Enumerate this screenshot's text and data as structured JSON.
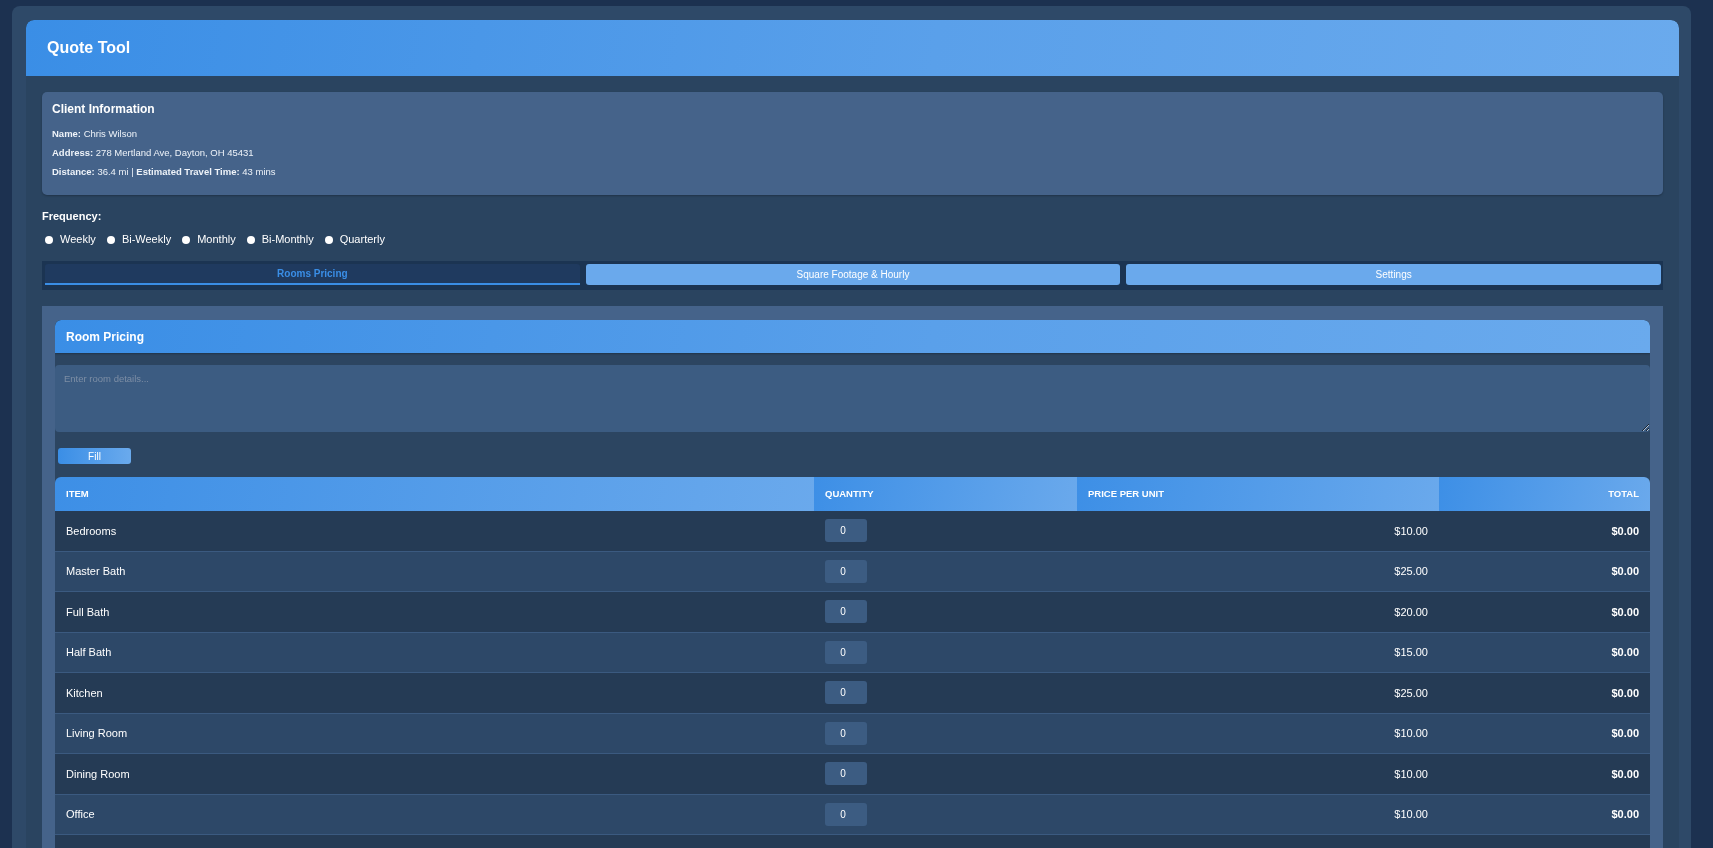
{
  "window": {
    "title": "Quote Tool"
  },
  "client_info": {
    "title": "Client Information",
    "lines": [
      "**Name:** Chris Wilson",
      "**Address:** 278 Mertland Ave, Dayton, OH 45431",
      "**Distance:** 36.4 mi | **Estimated Travel Time:** 43 mins"
    ]
  },
  "frequency": {
    "label": "Frequency:",
    "options": [
      {
        "label": "Weekly",
        "selected": false
      },
      {
        "label": "Bi-Weekly",
        "selected": false
      },
      {
        "label": "Monthly",
        "selected": false
      },
      {
        "label": "Bi-Monthly",
        "selected": false
      },
      {
        "label": "Quarterly",
        "selected": false
      }
    ]
  },
  "tabs": [
    {
      "label": "Rooms Pricing",
      "selected": true
    },
    {
      "label": "Square Footage & Hourly",
      "selected": false
    },
    {
      "label": "Settings",
      "selected": false
    }
  ],
  "room_pricing": {
    "title": "Room Pricing",
    "details_field": {
      "placeholder": "Enter room details..."
    },
    "fill_button": "Fill",
    "table": {
      "columns": [
        "ITEM",
        "QUANTITY",
        "PRICE PER UNIT",
        "TOTAL"
      ],
      "rows": [
        {
          "item": "Bedrooms",
          "quantity": "0",
          "price_per_unit": "$10.00",
          "total": "$0.00"
        },
        {
          "item": "Master Bath",
          "quantity": "0",
          "price_per_unit": "$25.00",
          "total": "$0.00"
        },
        {
          "item": "Full Bath",
          "quantity": "0",
          "price_per_unit": "$20.00",
          "total": "$0.00"
        },
        {
          "item": "Half Bath",
          "quantity": "0",
          "price_per_unit": "$15.00",
          "total": "$0.00"
        },
        {
          "item": "Kitchen",
          "quantity": "0",
          "price_per_unit": "$25.00",
          "total": "$0.00"
        },
        {
          "item": "Living Room",
          "quantity": "0",
          "price_per_unit": "$10.00",
          "total": "$0.00"
        },
        {
          "item": "Dining Room",
          "quantity": "0",
          "price_per_unit": "$10.00",
          "total": "$0.00"
        },
        {
          "item": "Office",
          "quantity": "0",
          "price_per_unit": "$10.00",
          "total": "$0.00"
        }
      ]
    }
  }
}
